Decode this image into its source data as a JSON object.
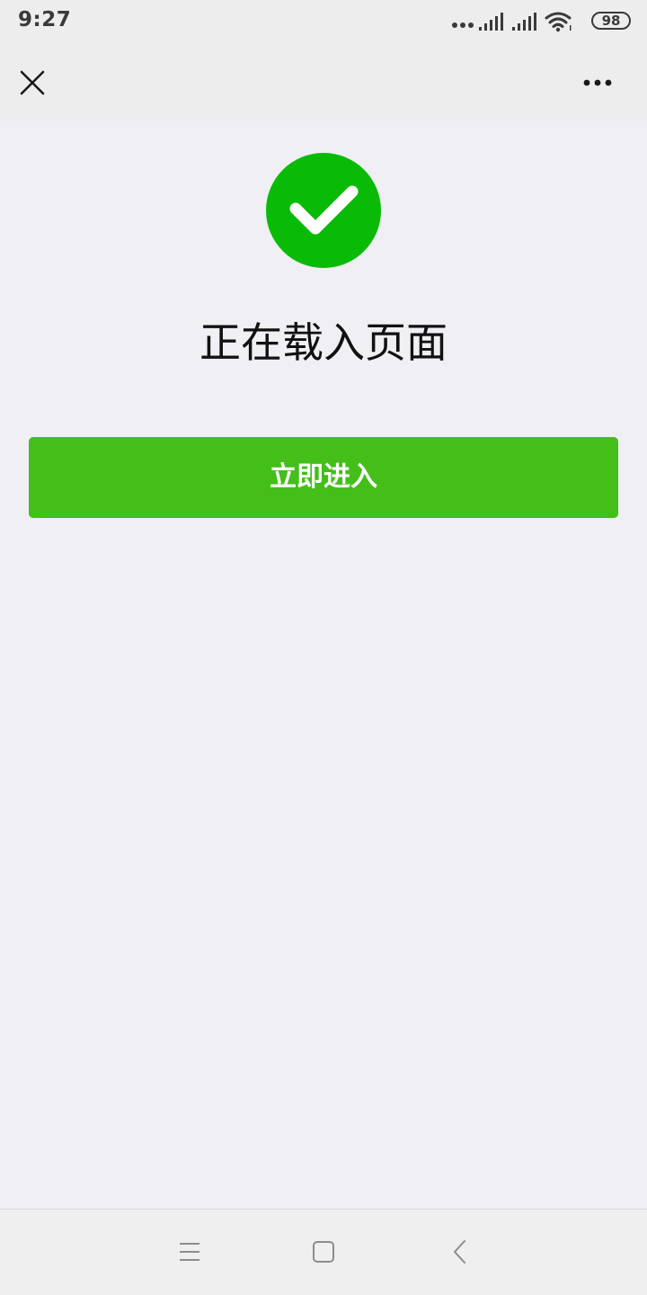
{
  "status_bar": {
    "time": "9:27",
    "battery_level": "98",
    "icons": [
      "more-dots-icon",
      "signal-icon",
      "signal-icon",
      "wifi-icon",
      "battery-icon"
    ]
  },
  "nav_bar": {
    "close_icon": "close-icon",
    "more_icon": "more-horizontal-icon"
  },
  "main": {
    "status_icon": "success-check-icon",
    "title": "正在载入页面",
    "enter_button_label": "立即进入"
  },
  "system_nav": {
    "icons": [
      "menu-icon",
      "home-icon",
      "back-icon"
    ]
  },
  "colors": {
    "success_green": "#09bb07",
    "button_green": "#44be19",
    "background": "#efeff4",
    "bar_background": "#ededed"
  }
}
